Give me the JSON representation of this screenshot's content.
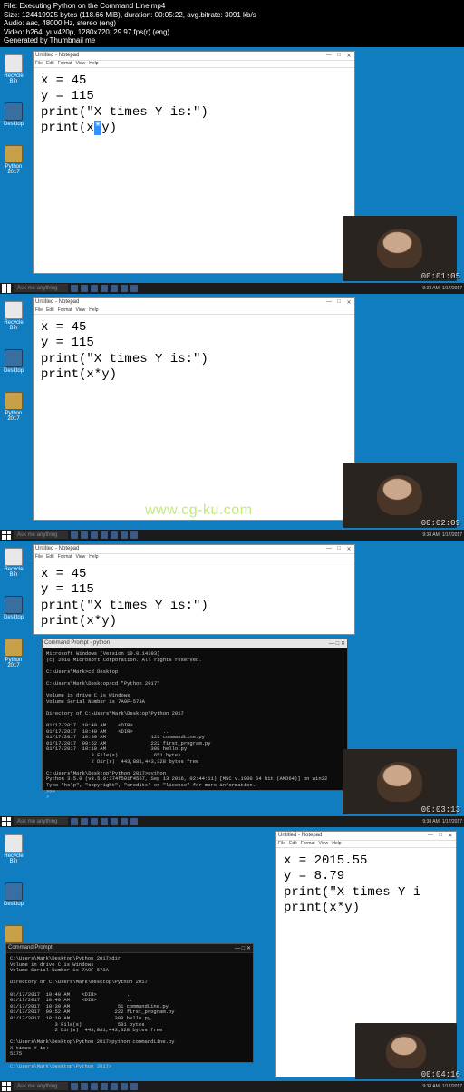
{
  "meta": {
    "l1": "File: Executing Python on the Command Line.mp4",
    "l2": "Size: 124419925 bytes (118.66 MiB), duration: 00:05:22, avg.bitrate: 3091 kb/s",
    "l3": "Audio: aac, 48000 Hz, stereo (eng)",
    "l4": "Video: h264, yuv420p, 1280x720, 29.97 fps(r) (eng)",
    "l5": "Generated by Thumbnail me"
  },
  "np_title": "Untitled - Notepad",
  "np_menu": {
    "file": "File",
    "edit": "Edit",
    "format": "Format",
    "view": "View",
    "help": "Help"
  },
  "wbtns": {
    "min": "—",
    "max": "□",
    "close": "✕"
  },
  "code1a": "x = 45\ny = 115\nprint(\"X times Y is:\")\nprint(x",
  "code1_sel": "*",
  "code1b": "y)",
  "code2": "x = 45\ny = 115\nprint(\"X times Y is:\")\nprint(x*y)",
  "code4": "x = 2015.55\ny = 8.79\nprint(\"X times Y i\nprint(x*y)",
  "cmd_title": "Command Prompt - python",
  "cmd_title2": "Command Prompt",
  "cmd3": "Microsoft Windows [Version 10.0.14393]\n(c) 2016 Microsoft Corporation. All rights reserved.\n\nC:\\Users\\Mark>cd Desktop\n\nC:\\Users\\Mark\\Desktop>cd \"Python 2017\"\n\nVolume in drive C is Windows\nVolume Serial Number is 7A0F-573A\n\nDirectory of C:\\Users\\Mark\\Desktop\\Python 2017\n\n01/17/2017  10:40 AM    <DIR>          .\n01/17/2017  10:40 AM    <DIR>          ..\n01/17/2017  10:39 AM               121 commandLine.py\n01/17/2017  09:52 AM               222 first_program.py\n01/17/2017  10:10 AM               308 hello.py\n               3 File(s)            651 bytes\n               2 Dir(s)  443,881,443,328 bytes free\n\nC:\\Users\\Mark\\Desktop\\Python 2017>python\nPython 3.5.0 (v3.5.0:374f501f4567, Sep 13 2016, 02:44:11) [MSC v.1900 64 bit (AMD64)] on win32\nType \"help\", \"copyright\", \"credits\" or \"license\" for more information.\n>>>\n>",
  "cmd4": "C:\\Users\\Mark\\Desktop\\Python 2017>dir\nVolume in drive C is Windows\nVolume Serial Number is 7A0F-573A\n\nDirectory of C:\\Users\\Mark\\Desktop\\Python 2017\n\n01/17/2017  10:40 AM    <DIR>          .\n01/17/2017  10:40 AM    <DIR>          ..\n01/17/2017  10:39 AM                51 commandLine.py\n01/17/2017  09:52 AM               222 first_program.py\n01/17/2017  10:10 AM               308 hello.py\n               3 File(s)            581 bytes\n               2 Dir(s)  443,881,443,328 bytes free\n\nC:\\Users\\Mark\\Desktop\\Python 2017>python commandLine.py\nX times Y is:\n5175\n\nC:\\Users\\Mark\\Desktop\\Python 2017>",
  "icons": {
    "recycle": "Recycle Bin",
    "desktop": "Desktop",
    "pylbl": "Python 2017"
  },
  "tb": {
    "search": "Ask me anything",
    "time": "9:38 AM",
    "date": "1/17/2017"
  },
  "ts": {
    "f1": "00:01:05",
    "f2": "00:02:09",
    "f3": "00:03:13",
    "f4": "00:04:16"
  },
  "watermark": "www.cg-ku.com"
}
